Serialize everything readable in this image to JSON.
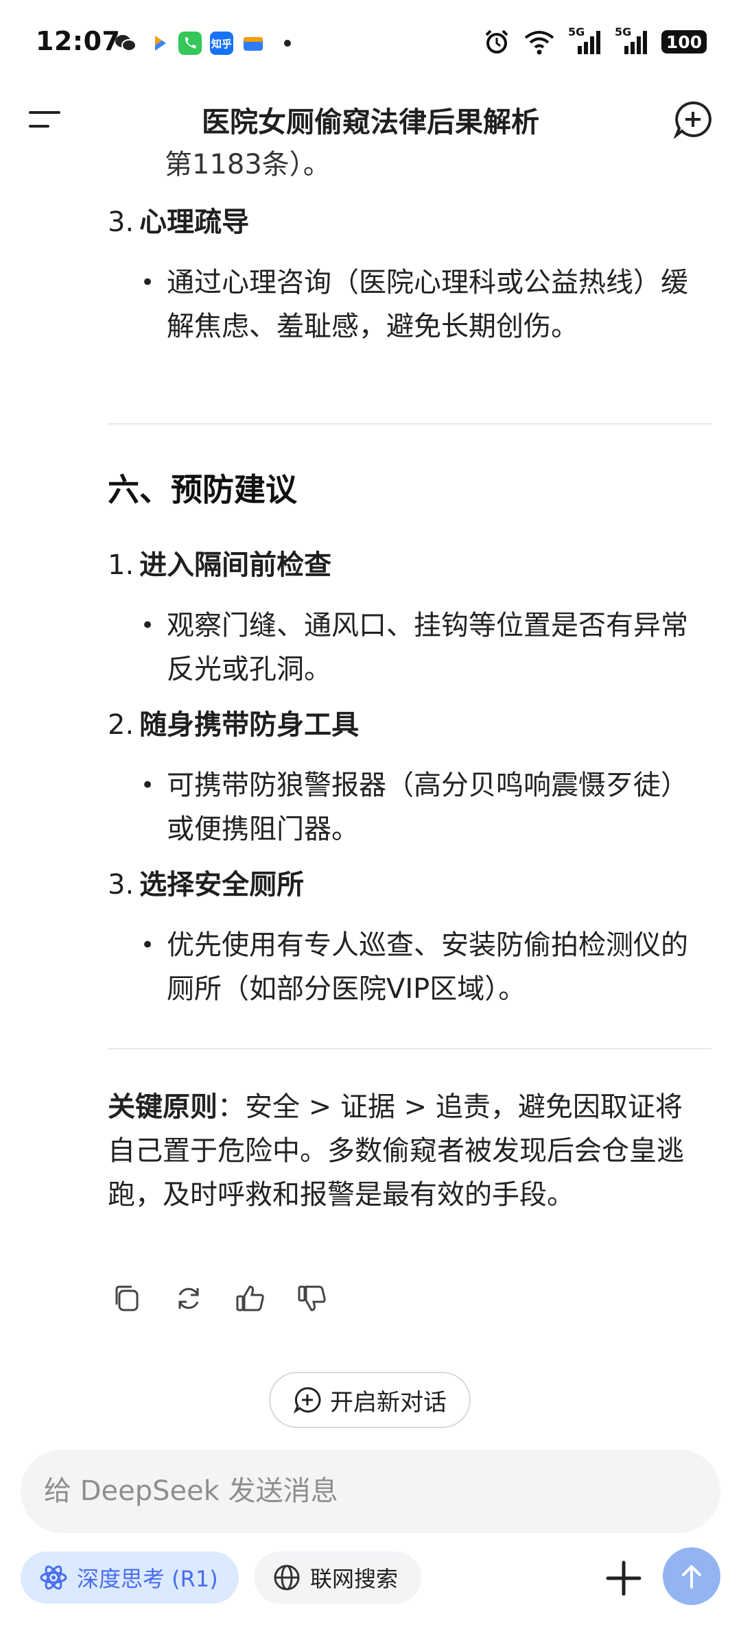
{
  "status_bar": {
    "time": "12:07",
    "app_icons": [
      "wechat-icon",
      "relay-icon",
      "phone-icon",
      "zhihu-icon",
      "inbox-icon",
      "more-dot-icon"
    ],
    "zhihu_label": "知乎",
    "network_1": "5G",
    "network_2": "5G",
    "battery": "100"
  },
  "header": {
    "title": "医院女厕偷窥法律后果解析"
  },
  "content": {
    "cut_line": "第1183条）。",
    "prev_section_item3": {
      "number": "3.",
      "title": "心理疏导",
      "bullet": "通过心理咨询（医院心理科或公益热线）缓解焦虑、羞耻感，避免长期创伤。"
    },
    "section6": {
      "heading": "六、预防建议",
      "items": [
        {
          "number": "1.",
          "title": "进入隔间前检查",
          "bullet": "观察门缝、通风口、挂钩等位置是否有异常反光或孔洞。"
        },
        {
          "number": "2.",
          "title": "随身携带防身工具",
          "bullet": "可携带防狼警报器（高分贝鸣响震慑歹徒）或便携阻门器。"
        },
        {
          "number": "3.",
          "title": "选择安全厕所",
          "bullet": "优先使用有专人巡查、安装防偷拍检测仪的厕所（如部分医院VIP区域）。"
        }
      ]
    },
    "summary": {
      "label": "关键原则",
      "colon": "：",
      "text": "安全 > 证据 > 追责，避免因取证将自己置于危险中。多数偷窥者被发现后会仓皇逃跑，及时呼救和报警是最有效的手段。"
    }
  },
  "actions": [
    "copy-icon",
    "regenerate-icon",
    "thumbs-up-icon",
    "thumbs-down-icon"
  ],
  "new_chat_button": "开启新对话",
  "composer": {
    "placeholder": "给 DeepSeek 发送消息",
    "deep_think": "深度思考 (R1)",
    "web_search": "联网搜索"
  },
  "colors": {
    "accent": "#4a6cf0",
    "deep_think_bg": "#dbeafe",
    "send_button": "#92b4f3",
    "input_bg": "#f3f4f6"
  }
}
